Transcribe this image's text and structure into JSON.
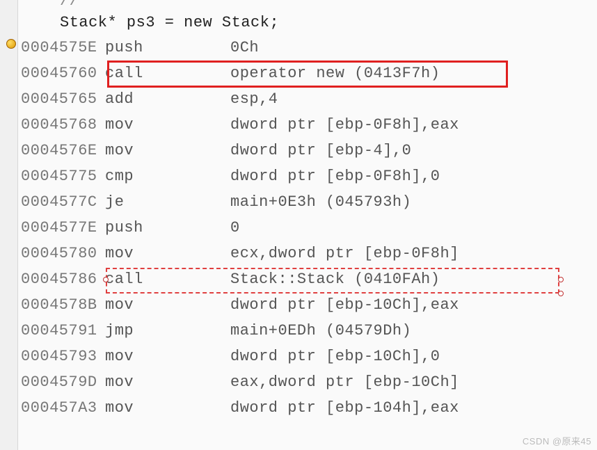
{
  "source": {
    "comment": "//",
    "code": "Stack* ps3 = new Stack;"
  },
  "asm": [
    {
      "addr": "0004575E",
      "mnem": "push",
      "oper": "0Ch"
    },
    {
      "addr": "00045760",
      "mnem": "call",
      "oper": "operator new (0413F7h)"
    },
    {
      "addr": "00045765",
      "mnem": "add",
      "oper": "esp,4"
    },
    {
      "addr": "00045768",
      "mnem": "mov",
      "oper": "dword ptr [ebp-0F8h],eax"
    },
    {
      "addr": "0004576E",
      "mnem": "mov",
      "oper": "dword ptr [ebp-4],0"
    },
    {
      "addr": "00045775",
      "mnem": "cmp",
      "oper": "dword ptr [ebp-0F8h],0"
    },
    {
      "addr": "0004577C",
      "mnem": "je",
      "oper": "main+0E3h (045793h)"
    },
    {
      "addr": "0004577E",
      "mnem": "push",
      "oper": "0"
    },
    {
      "addr": "00045780",
      "mnem": "mov",
      "oper": "ecx,dword ptr [ebp-0F8h]"
    },
    {
      "addr": "00045786",
      "mnem": "call",
      "oper": "Stack::Stack (0410FAh)"
    },
    {
      "addr": "0004578B",
      "mnem": "mov",
      "oper": "dword ptr [ebp-10Ch],eax"
    },
    {
      "addr": "00045791",
      "mnem": "jmp",
      "oper": "main+0EDh (04579Dh)"
    },
    {
      "addr": "00045793",
      "mnem": "mov",
      "oper": "dword ptr [ebp-10Ch],0"
    },
    {
      "addr": "0004579D",
      "mnem": "mov",
      "oper": "eax,dword ptr [ebp-10Ch]"
    },
    {
      "addr": "000457A3",
      "mnem": "mov",
      "oper": "dword ptr [ebp-104h],eax"
    }
  ],
  "watermark": "CSDN @原来45"
}
